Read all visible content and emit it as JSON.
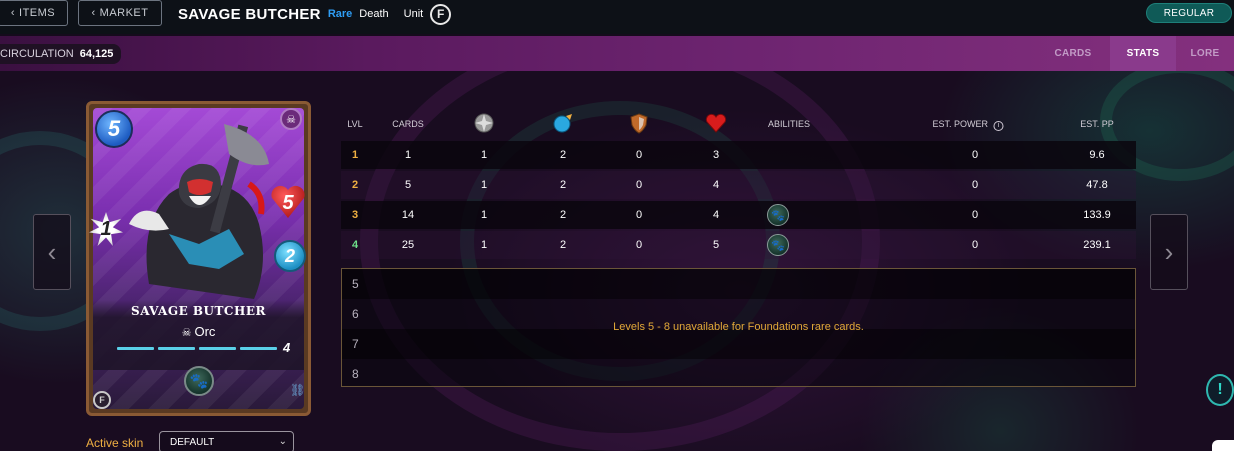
{
  "topbar": {
    "items_btn": "ITEMS",
    "market_btn": "MARKET",
    "card_name": "SAVAGE BUTCHER",
    "rarity": "Rare",
    "element": "Death",
    "card_type": "Unit",
    "edition_icon": "F",
    "foil_btn": "REGULAR"
  },
  "strip": {
    "circulation_label": "CIRCULATION",
    "circulation_value": "64,125",
    "tabs": [
      {
        "label": "CARDS",
        "active": false
      },
      {
        "label": "STATS",
        "active": true
      },
      {
        "label": "LORE",
        "active": false
      }
    ]
  },
  "card": {
    "mana": "5",
    "attack": "1",
    "health": "5",
    "speed": "2",
    "name": "SAVAGE BUTCHER",
    "race": "Orc",
    "level": "4",
    "edition": "F",
    "element_icon": "skull-icon",
    "ability_icon": "ability-icon"
  },
  "skin": {
    "label": "Active skin",
    "value": "DEFAULT"
  },
  "table": {
    "headers": {
      "lvl": "LVL",
      "cards": "CARDS",
      "abilities": "ABILITIES",
      "est_power": "EST. POWER",
      "est_pp": "EST. PP"
    },
    "header_icons": [
      "attack-icon",
      "speed-icon",
      "armor-icon",
      "health-icon"
    ],
    "rows": [
      {
        "lvl": "1",
        "cards": "1",
        "attack": "1",
        "speed": "2",
        "armor": "0",
        "health": "3",
        "ability": false,
        "est_power": "0",
        "est_pp": "9.6"
      },
      {
        "lvl": "2",
        "cards": "5",
        "attack": "1",
        "speed": "2",
        "armor": "0",
        "health": "4",
        "ability": false,
        "est_power": "0",
        "est_pp": "47.8"
      },
      {
        "lvl": "3",
        "cards": "14",
        "attack": "1",
        "speed": "2",
        "armor": "0",
        "health": "4",
        "ability": true,
        "est_power": "0",
        "est_pp": "133.9"
      },
      {
        "lvl": "4",
        "cards": "25",
        "attack": "1",
        "speed": "2",
        "armor": "0",
        "health": "5",
        "ability": true,
        "est_power": "0",
        "est_pp": "239.1"
      }
    ],
    "lvl_colors": [
      "#f0b042",
      "#f0b042",
      "#f0b042",
      "#6ee08a"
    ],
    "unavailable_levels": [
      "5",
      "6",
      "7",
      "8"
    ],
    "unavailable_msg": "Levels 5 - 8 unavailable for Foundations rare cards."
  },
  "help_btn": "!"
}
